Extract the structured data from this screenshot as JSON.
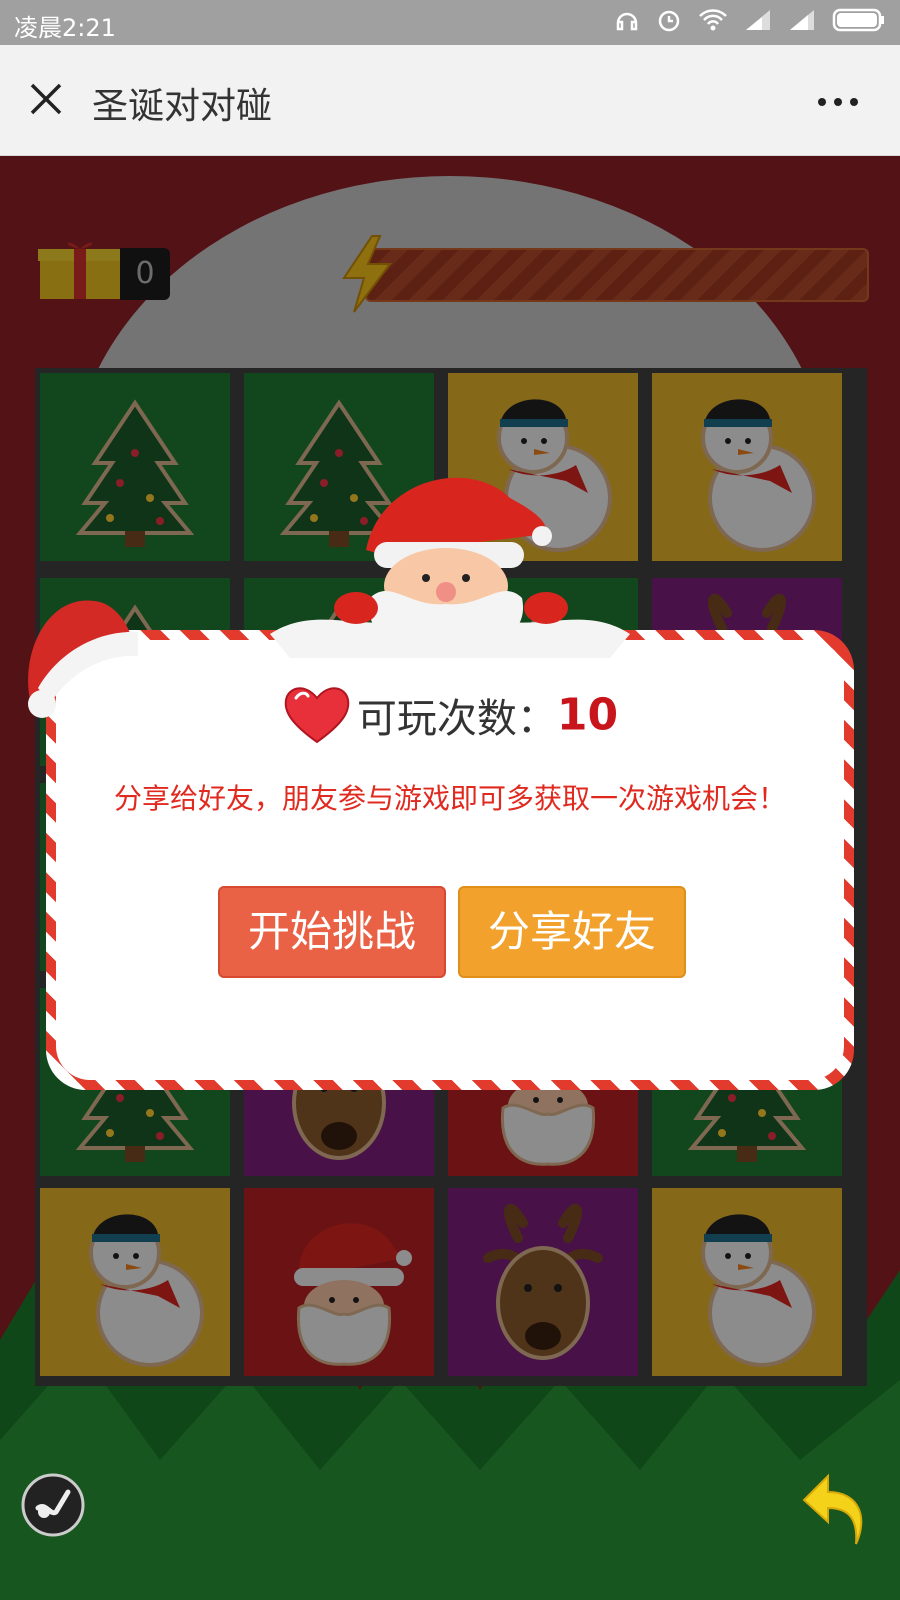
{
  "status_bar": {
    "time": "凌晨2:21"
  },
  "nav": {
    "title": "圣诞对对碰"
  },
  "hud": {
    "score": "0"
  },
  "board": {
    "rows": [
      [
        "tree",
        "tree",
        "snowman",
        "snowman"
      ],
      [
        "tree",
        "tree",
        "tree",
        "reindeer"
      ],
      [
        "tree",
        "reindeer",
        "santa",
        "tree"
      ],
      [
        "snowman",
        "santa",
        "reindeer",
        "snowman"
      ]
    ],
    "tile_colors": {
      "tree": "#1f7a33",
      "snowman": "#e5b52c",
      "reindeer": "#7d1e7a",
      "santa": "#b82224"
    }
  },
  "dialog": {
    "count_label": "可玩次数：",
    "count_value": "10",
    "hint": "分享给好友，朋友参与游戏即可多获取一次游戏机会！",
    "start_button": "开始挑战",
    "share_button": "分享好友"
  },
  "colors": {
    "accent_red": "#c8151b",
    "start_btn": "#ea6246",
    "share_btn": "#f2a12d"
  }
}
